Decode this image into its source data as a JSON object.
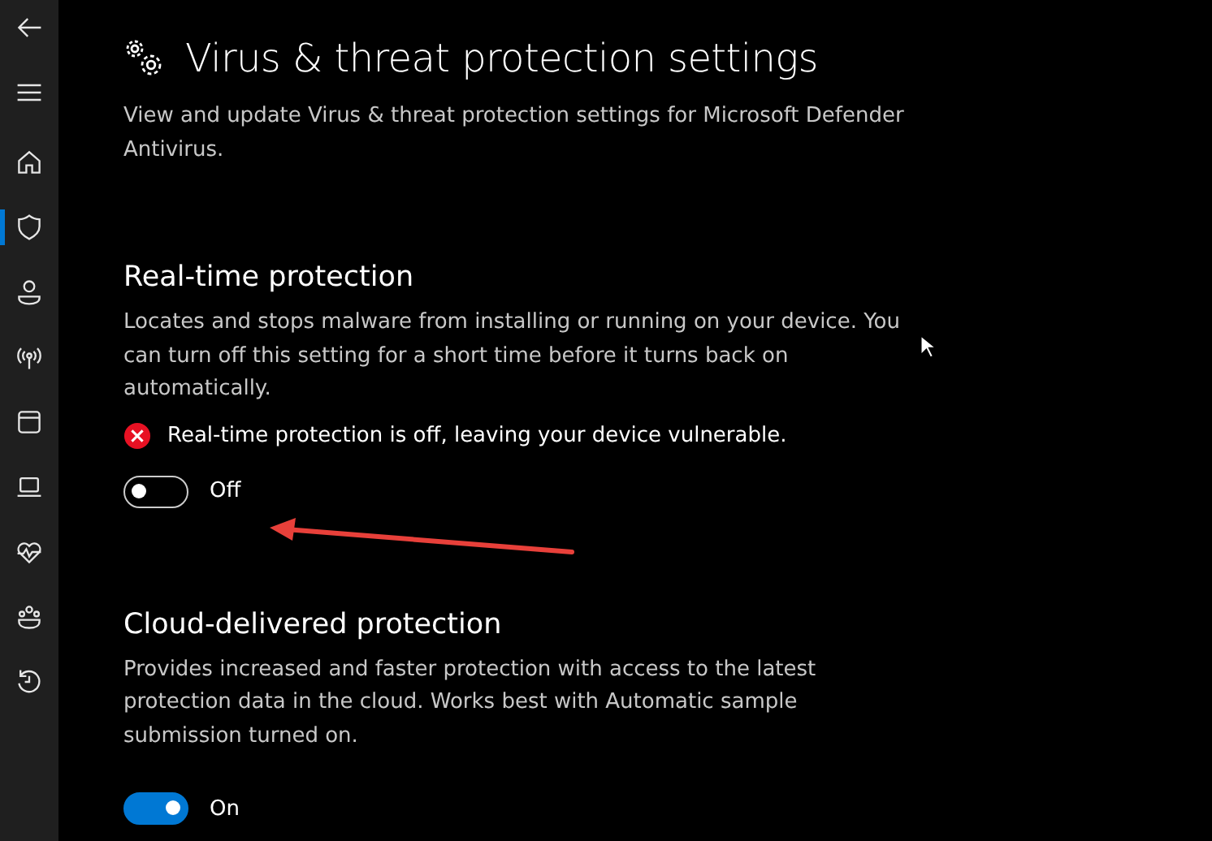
{
  "sidebar": {
    "items": [
      {
        "selected": false
      },
      {
        "selected": false
      },
      {
        "selected": false
      },
      {
        "selected": true
      },
      {
        "selected": false
      },
      {
        "selected": false
      },
      {
        "selected": false
      },
      {
        "selected": false
      },
      {
        "selected": false
      },
      {
        "selected": false
      },
      {
        "selected": false
      }
    ]
  },
  "page": {
    "title": "Virus & threat protection settings",
    "description": "View and update Virus & threat protection settings for Microsoft Defender Antivirus."
  },
  "sections": [
    {
      "heading": "Real-time protection",
      "description": "Locates and stops malware from installing or running on your device. You can turn off this setting for a short time before it turns back on automatically.",
      "warning": "Real-time protection is off, leaving your device vulnerable.",
      "toggle": {
        "on": false,
        "label": "Off"
      }
    },
    {
      "heading": "Cloud-delivered protection",
      "description": "Provides increased and faster protection with access to the latest protection data in the cloud. Works best with Automatic sample submission turned on.",
      "toggle": {
        "on": true,
        "label": "On"
      }
    }
  ]
}
